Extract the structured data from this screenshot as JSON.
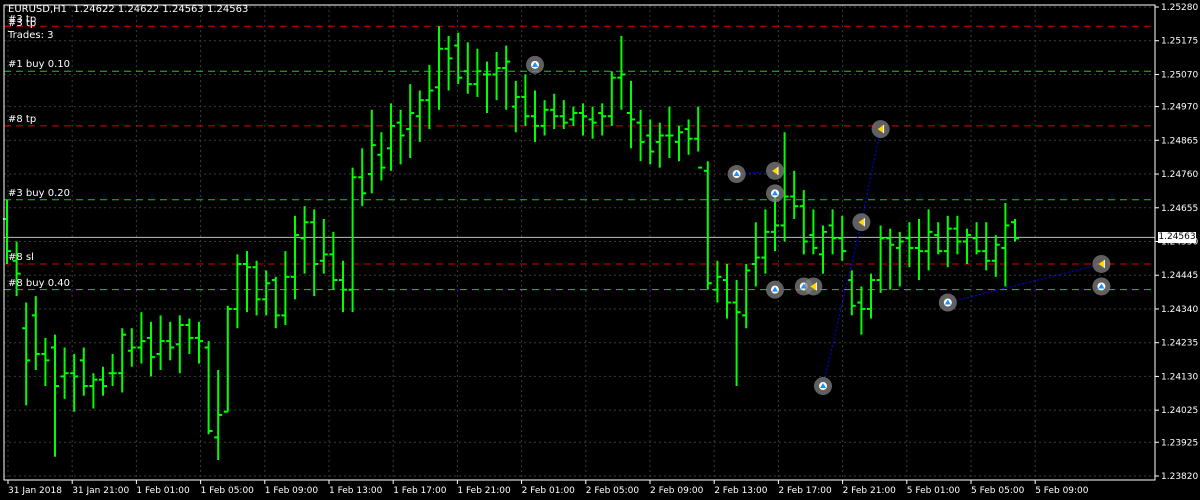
{
  "header": {
    "symbol_line": "EURUSD,H1  1.24622 1.24622 1.24563 1.24563",
    "tp_label": "#3 tp",
    "trades_label": "Trades: 3"
  },
  "colors": {
    "background": "#000000",
    "grid": "#3a3a3a",
    "bar": "#00ff00",
    "take_profit": "#ff0000",
    "entry": "#00ff00",
    "current_price": "#c0c0c0",
    "trade_path": "#0000ff",
    "marker_ring": "#808080",
    "marker_buy": "#1e90ff",
    "marker_close": "#ffd700",
    "axis_text": "#ffffff"
  },
  "chart_data": {
    "type": "ohlc",
    "symbol": "EURUSD",
    "timeframe": "H1",
    "ylim": [
      1.2382,
      1.2528
    ],
    "grid": true,
    "y_ticks": [
      "1.25280",
      "1.25175",
      "1.25070",
      "1.24970",
      "1.24865",
      "1.24760",
      "1.24655",
      "1.24550",
      "1.24445",
      "1.24340",
      "1.24235",
      "1.24130",
      "1.24025",
      "1.23925",
      "1.23820"
    ],
    "x_ticks": [
      "31 Jan 2018",
      "31 Jan 21:00",
      "1 Feb 01:00",
      "1 Feb 05:00",
      "1 Feb 09:00",
      "1 Feb 13:00",
      "1 Feb 17:00",
      "1 Feb 21:00",
      "2 Feb 01:00",
      "2 Feb 05:00",
      "2 Feb 09:00",
      "2 Feb 13:00",
      "2 Feb 17:00",
      "2 Feb 21:00",
      "5 Feb 01:00",
      "5 Feb 05:00",
      "5 Feb 09:00"
    ],
    "current_price": 1.24563,
    "current_price_label": "1.24563",
    "levels": [
      {
        "label": "#3 tp",
        "price": 1.2522,
        "kind": "tp"
      },
      {
        "label": "#1 buy 0.10",
        "price": 1.2508,
        "kind": "entry"
      },
      {
        "label": "#8 tp",
        "price": 1.2491,
        "kind": "tp"
      },
      {
        "label": "#3 buy 0.20",
        "price": 1.2468,
        "kind": "entry"
      },
      {
        "label": "#8 sl",
        "price": 1.2448,
        "kind": "sl"
      },
      {
        "label": "#8 buy 0.40",
        "price": 1.244,
        "kind": "entry"
      }
    ],
    "bars": [
      {
        "o": 1.2462,
        "h": 1.2468,
        "l": 1.2448,
        "c": 1.2452
      },
      {
        "o": 1.2449,
        "h": 1.2455,
        "l": 1.2438,
        "c": 1.2445
      },
      {
        "o": 1.2428,
        "h": 1.2436,
        "l": 1.2404,
        "c": 1.2418
      },
      {
        "o": 1.2432,
        "h": 1.2438,
        "l": 1.2415,
        "c": 1.242
      },
      {
        "o": 1.242,
        "h": 1.2425,
        "l": 1.241,
        "c": 1.2418
      },
      {
        "o": 1.2422,
        "h": 1.2426,
        "l": 1.2388,
        "c": 1.241
      },
      {
        "o": 1.2413,
        "h": 1.2422,
        "l": 1.2406,
        "c": 1.2414
      },
      {
        "o": 1.2414,
        "h": 1.242,
        "l": 1.2402,
        "c": 1.2413
      },
      {
        "o": 1.2418,
        "h": 1.2422,
        "l": 1.2407,
        "c": 1.241
      },
      {
        "o": 1.241,
        "h": 1.2414,
        "l": 1.2403,
        "c": 1.2412
      },
      {
        "o": 1.2412,
        "h": 1.2416,
        "l": 1.2407,
        "c": 1.241
      },
      {
        "o": 1.2414,
        "h": 1.242,
        "l": 1.241,
        "c": 1.2414
      },
      {
        "o": 1.2414,
        "h": 1.2428,
        "l": 1.2408,
        "c": 1.2426
      },
      {
        "o": 1.2421,
        "h": 1.2428,
        "l": 1.2416,
        "c": 1.2422
      },
      {
        "o": 1.2422,
        "h": 1.2433,
        "l": 1.2417,
        "c": 1.2424
      },
      {
        "o": 1.2425,
        "h": 1.243,
        "l": 1.2413,
        "c": 1.2419
      },
      {
        "o": 1.242,
        "h": 1.2432,
        "l": 1.2415,
        "c": 1.2424
      },
      {
        "o": 1.2424,
        "h": 1.243,
        "l": 1.2418,
        "c": 1.2422
      },
      {
        "o": 1.2423,
        "h": 1.2432,
        "l": 1.2414,
        "c": 1.2429
      },
      {
        "o": 1.2429,
        "h": 1.2431,
        "l": 1.242,
        "c": 1.2425
      },
      {
        "o": 1.2425,
        "h": 1.243,
        "l": 1.2417,
        "c": 1.2424
      },
      {
        "o": 1.2422,
        "h": 1.2424,
        "l": 1.2395,
        "c": 1.2396
      },
      {
        "o": 1.2394,
        "h": 1.2415,
        "l": 1.2387,
        "c": 1.2401
      },
      {
        "o": 1.2402,
        "h": 1.2435,
        "l": 1.2402,
        "c": 1.2434
      },
      {
        "o": 1.2434,
        "h": 1.2451,
        "l": 1.2428,
        "c": 1.2448
      },
      {
        "o": 1.2448,
        "h": 1.2452,
        "l": 1.2433,
        "c": 1.2447
      },
      {
        "o": 1.2447,
        "h": 1.2449,
        "l": 1.2432,
        "c": 1.2437
      },
      {
        "o": 1.2437,
        "h": 1.2446,
        "l": 1.2432,
        "c": 1.2442
      },
      {
        "o": 1.2443,
        "h": 1.2444,
        "l": 1.2428,
        "c": 1.2432
      },
      {
        "o": 1.2432,
        "h": 1.2452,
        "l": 1.2429,
        "c": 1.2444
      },
      {
        "o": 1.2444,
        "h": 1.2463,
        "l": 1.2437,
        "c": 1.2457
      },
      {
        "o": 1.2456,
        "h": 1.2466,
        "l": 1.2445,
        "c": 1.2461
      },
      {
        "o": 1.2461,
        "h": 1.2465,
        "l": 1.2438,
        "c": 1.2448
      },
      {
        "o": 1.2449,
        "h": 1.2462,
        "l": 1.2445,
        "c": 1.2451
      },
      {
        "o": 1.2451,
        "h": 1.2458,
        "l": 1.244,
        "c": 1.2443
      },
      {
        "o": 1.2443,
        "h": 1.2449,
        "l": 1.2433,
        "c": 1.244
      },
      {
        "o": 1.244,
        "h": 1.2478,
        "l": 1.2433,
        "c": 1.2475
      },
      {
        "o": 1.2475,
        "h": 1.2484,
        "l": 1.2466,
        "c": 1.247
      },
      {
        "o": 1.2476,
        "h": 1.2496,
        "l": 1.247,
        "c": 1.2485
      },
      {
        "o": 1.2482,
        "h": 1.2489,
        "l": 1.2474,
        "c": 1.2478
      },
      {
        "o": 1.2484,
        "h": 1.2498,
        "l": 1.2477,
        "c": 1.2491
      },
      {
        "o": 1.2492,
        "h": 1.2496,
        "l": 1.2479,
        "c": 1.2488
      },
      {
        "o": 1.249,
        "h": 1.2504,
        "l": 1.2481,
        "c": 1.2495
      },
      {
        "o": 1.2494,
        "h": 1.2502,
        "l": 1.2486,
        "c": 1.2499
      },
      {
        "o": 1.2499,
        "h": 1.251,
        "l": 1.249,
        "c": 1.2502
      },
      {
        "o": 1.2503,
        "h": 1.2522,
        "l": 1.2496,
        "c": 1.2515
      },
      {
        "o": 1.2515,
        "h": 1.2519,
        "l": 1.2502,
        "c": 1.2512
      },
      {
        "o": 1.2516,
        "h": 1.252,
        "l": 1.2504,
        "c": 1.2506
      },
      {
        "o": 1.2508,
        "h": 1.2517,
        "l": 1.2501,
        "c": 1.2504
      },
      {
        "o": 1.2504,
        "h": 1.2515,
        "l": 1.25,
        "c": 1.2508
      },
      {
        "o": 1.2507,
        "h": 1.2511,
        "l": 1.2495,
        "c": 1.2507
      },
      {
        "o": 1.2507,
        "h": 1.2514,
        "l": 1.2499,
        "c": 1.2509
      },
      {
        "o": 1.2509,
        "h": 1.2516,
        "l": 1.2496,
        "c": 1.2511
      },
      {
        "o": 1.2497,
        "h": 1.2505,
        "l": 1.2489,
        "c": 1.25
      },
      {
        "o": 1.25,
        "h": 1.2507,
        "l": 1.2491,
        "c": 1.2494
      },
      {
        "o": 1.2494,
        "h": 1.2502,
        "l": 1.2486,
        "c": 1.2491
      },
      {
        "o": 1.2491,
        "h": 1.2499,
        "l": 1.2488,
        "c": 1.2496
      },
      {
        "o": 1.2496,
        "h": 1.2501,
        "l": 1.249,
        "c": 1.2494
      },
      {
        "o": 1.2494,
        "h": 1.2499,
        "l": 1.249,
        "c": 1.2492
      },
      {
        "o": 1.2493,
        "h": 1.2497,
        "l": 1.2491,
        "c": 1.2495
      },
      {
        "o": 1.2495,
        "h": 1.2498,
        "l": 1.2488,
        "c": 1.2494
      },
      {
        "o": 1.2493,
        "h": 1.2497,
        "l": 1.2487,
        "c": 1.2492
      },
      {
        "o": 1.2495,
        "h": 1.2498,
        "l": 1.2488,
        "c": 1.2494
      },
      {
        "o": 1.2494,
        "h": 1.2508,
        "l": 1.2491,
        "c": 1.2506
      },
      {
        "o": 1.2506,
        "h": 1.2519,
        "l": 1.2496,
        "c": 1.2507
      },
      {
        "o": 1.2495,
        "h": 1.2505,
        "l": 1.2484,
        "c": 1.2493
      },
      {
        "o": 1.2492,
        "h": 1.2496,
        "l": 1.248,
        "c": 1.2486
      },
      {
        "o": 1.2488,
        "h": 1.2493,
        "l": 1.2479,
        "c": 1.2483
      },
      {
        "o": 1.2486,
        "h": 1.2492,
        "l": 1.2478,
        "c": 1.2488
      },
      {
        "o": 1.2488,
        "h": 1.2497,
        "l": 1.2481,
        "c": 1.2488
      },
      {
        "o": 1.2486,
        "h": 1.2491,
        "l": 1.248,
        "c": 1.2489
      },
      {
        "o": 1.249,
        "h": 1.2493,
        "l": 1.2482,
        "c": 1.2487
      },
      {
        "o": 1.2487,
        "h": 1.2497,
        "l": 1.2483,
        "c": 1.2478
      },
      {
        "o": 1.2477,
        "h": 1.248,
        "l": 1.244,
        "c": 1.2442
      },
      {
        "o": 1.244,
        "h": 1.2449,
        "l": 1.2436,
        "c": 1.2444
      },
      {
        "o": 1.2443,
        "h": 1.2448,
        "l": 1.2431,
        "c": 1.2436
      },
      {
        "o": 1.2436,
        "h": 1.2443,
        "l": 1.241,
        "c": 1.2433
      },
      {
        "o": 1.2432,
        "h": 1.2448,
        "l": 1.2428,
        "c": 1.2446
      },
      {
        "o": 1.2448,
        "h": 1.2461,
        "l": 1.2441,
        "c": 1.245
      },
      {
        "o": 1.245,
        "h": 1.2465,
        "l": 1.2445,
        "c": 1.2458
      },
      {
        "o": 1.2458,
        "h": 1.2471,
        "l": 1.2452,
        "c": 1.246
      },
      {
        "o": 1.246,
        "h": 1.2489,
        "l": 1.2455,
        "c": 1.2469
      },
      {
        "o": 1.2469,
        "h": 1.2477,
        "l": 1.2462,
        "c": 1.2466
      },
      {
        "o": 1.2466,
        "h": 1.2471,
        "l": 1.2451,
        "c": 1.2455
      },
      {
        "o": 1.2457,
        "h": 1.2465,
        "l": 1.2451,
        "c": 1.2453
      },
      {
        "o": 1.2451,
        "h": 1.246,
        "l": 1.2445,
        "c": 1.2458
      },
      {
        "o": 1.246,
        "h": 1.2465,
        "l": 1.2451,
        "c": 1.2456
      },
      {
        "o": 1.2456,
        "h": 1.2463,
        "l": 1.2449,
        "c": 1.2452
      },
      {
        "o": 1.2443,
        "h": 1.2446,
        "l": 1.2432,
        "c": 1.2435
      },
      {
        "o": 1.2436,
        "h": 1.2441,
        "l": 1.2426,
        "c": 1.2434
      },
      {
        "o": 1.2434,
        "h": 1.2445,
        "l": 1.2431,
        "c": 1.2443
      },
      {
        "o": 1.2443,
        "h": 1.246,
        "l": 1.2439,
        "c": 1.2456
      },
      {
        "o": 1.2456,
        "h": 1.2459,
        "l": 1.244,
        "c": 1.2454
      },
      {
        "o": 1.2453,
        "h": 1.2458,
        "l": 1.2441,
        "c": 1.2455
      },
      {
        "o": 1.2456,
        "h": 1.2461,
        "l": 1.2447,
        "c": 1.2453
      },
      {
        "o": 1.2453,
        "h": 1.2462,
        "l": 1.2443,
        "c": 1.2452
      },
      {
        "o": 1.2452,
        "h": 1.2465,
        "l": 1.2446,
        "c": 1.2458
      },
      {
        "o": 1.2457,
        "h": 1.2461,
        "l": 1.2451,
        "c": 1.2452
      },
      {
        "o": 1.2452,
        "h": 1.2463,
        "l": 1.2447,
        "c": 1.2459
      },
      {
        "o": 1.2459,
        "h": 1.2463,
        "l": 1.2451,
        "c": 1.2455
      },
      {
        "o": 1.2455,
        "h": 1.2459,
        "l": 1.2448,
        "c": 1.2457
      },
      {
        "o": 1.2456,
        "h": 1.2461,
        "l": 1.2451,
        "c": 1.2452
      },
      {
        "o": 1.2452,
        "h": 1.2461,
        "l": 1.2446,
        "c": 1.2449
      },
      {
        "o": 1.2449,
        "h": 1.2457,
        "l": 1.2444,
        "c": 1.2454
      },
      {
        "o": 1.2453,
        "h": 1.2467,
        "l": 1.2441,
        "c": 1.246
      },
      {
        "o": 1.2461,
        "h": 1.2462,
        "l": 1.2455,
        "c": 1.2456
      }
    ],
    "markers": [
      {
        "bar": 55,
        "price": 1.251,
        "kind": "buy"
      },
      {
        "bar": 76,
        "price": 1.2476,
        "kind": "buy"
      },
      {
        "bar": 80,
        "price": 1.2477,
        "kind": "close"
      },
      {
        "bar": 80,
        "price": 1.247,
        "kind": "buy"
      },
      {
        "bar": 80,
        "price": 1.244,
        "kind": "buy"
      },
      {
        "bar": 83,
        "price": 1.2441,
        "kind": "buy"
      },
      {
        "bar": 84,
        "price": 1.2441,
        "kind": "close"
      },
      {
        "bar": 85,
        "price": 1.241,
        "kind": "buy"
      },
      {
        "bar": 89,
        "price": 1.2461,
        "kind": "close"
      },
      {
        "bar": 91,
        "price": 1.249,
        "kind": "close"
      },
      {
        "bar": 98,
        "price": 1.2436,
        "kind": "buy"
      },
      {
        "bar": 114,
        "price": 1.2448,
        "kind": "close"
      },
      {
        "bar": 114,
        "price": 1.2441,
        "kind": "buy"
      }
    ],
    "trade_paths": [
      [
        {
          "bar": 76,
          "price": 1.2476
        },
        {
          "bar": 80,
          "price": 1.2477
        }
      ],
      [
        {
          "bar": 85,
          "price": 1.241
        },
        {
          "bar": 89,
          "price": 1.2461
        },
        {
          "bar": 91,
          "price": 1.249
        }
      ],
      [
        {
          "bar": 98,
          "price": 1.2436
        },
        {
          "bar": 114,
          "price": 1.2448
        }
      ]
    ]
  }
}
